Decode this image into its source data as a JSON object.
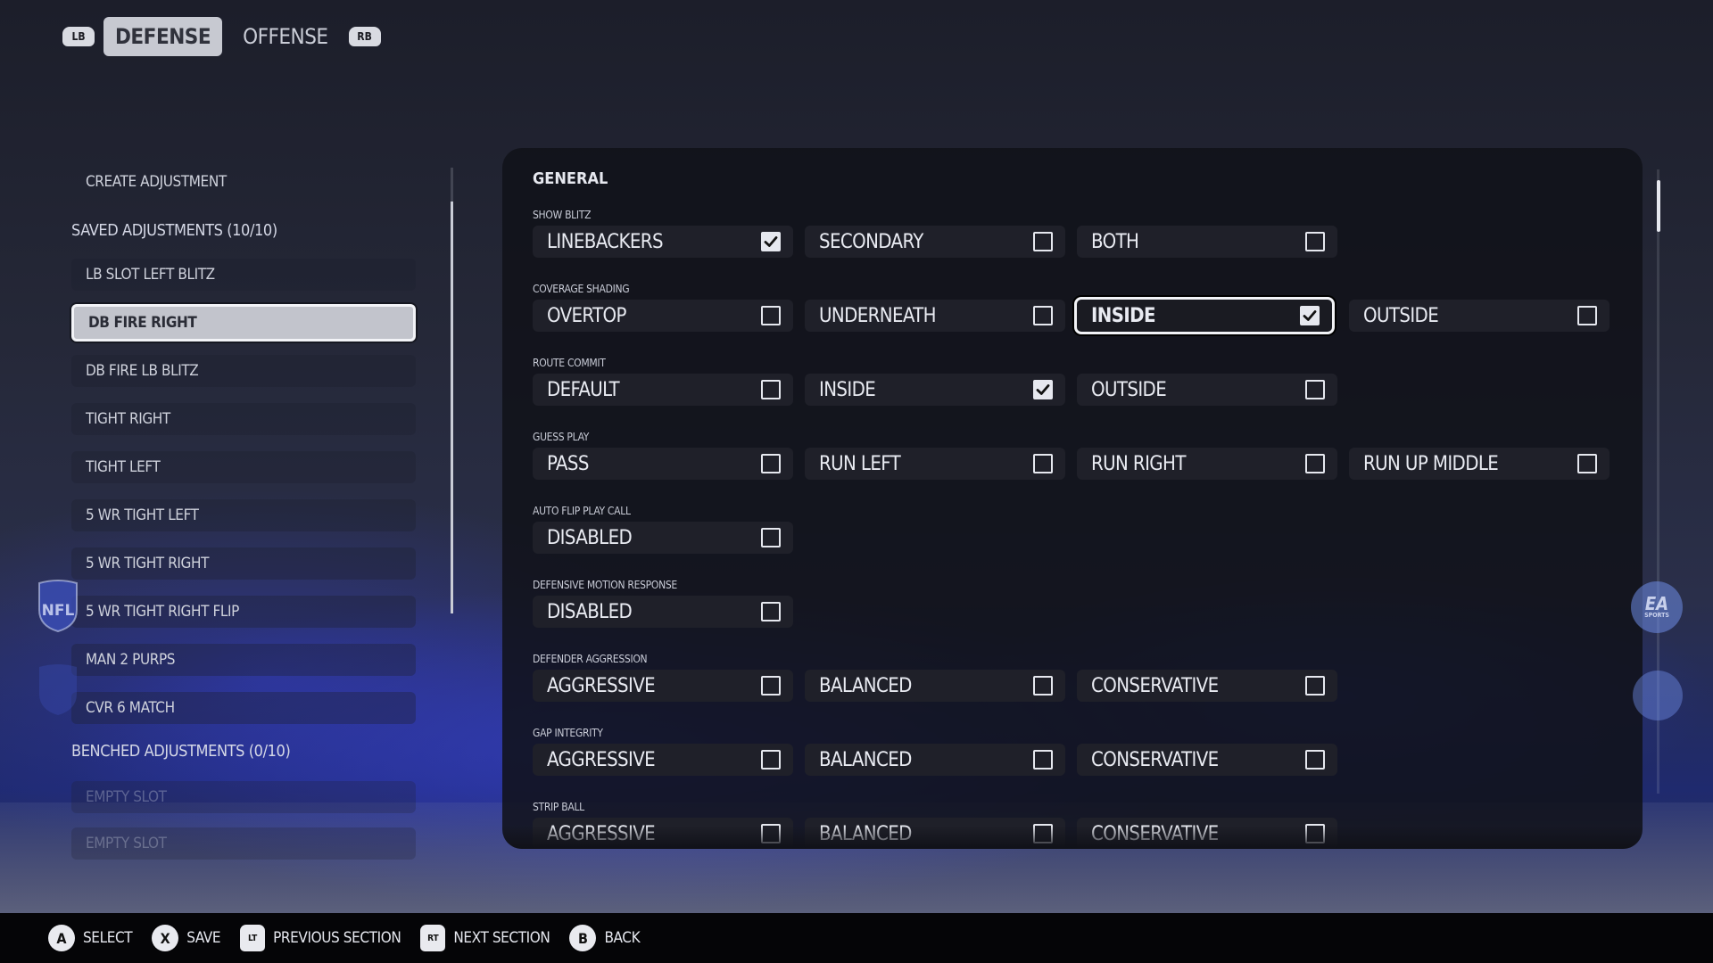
{
  "tabs": {
    "lb": "LB",
    "rb": "RB",
    "defense": "DEFENSE",
    "offense": "OFFENSE"
  },
  "left": {
    "create": "CREATE ADJUSTMENT",
    "saved_header": "SAVED ADJUSTMENTS (10/10)",
    "saved": [
      "LB SLOT LEFT BLITZ",
      "DB FIRE RIGHT",
      "DB FIRE LB BLITZ",
      "TIGHT RIGHT",
      "TIGHT LEFT",
      "5 WR TIGHT LEFT",
      "5 WR TIGHT RIGHT",
      "5 WR TIGHT RIGHT FLIP",
      "MAN 2 PURPS",
      "CVR 6 MATCH"
    ],
    "selected_index": 1,
    "benched_header": "BENCHED ADJUSTMENTS (0/10)",
    "benched": [
      "EMPTY SLOT",
      "EMPTY SLOT"
    ]
  },
  "panel": {
    "title": "GENERAL",
    "groups": [
      {
        "label": "SHOW BLITZ",
        "options": [
          {
            "label": "LINEBACKERS",
            "checked": true
          },
          {
            "label": "SECONDARY",
            "checked": false
          },
          {
            "label": "BOTH",
            "checked": false
          }
        ]
      },
      {
        "label": "COVERAGE SHADING",
        "options": [
          {
            "label": "OVERTOP",
            "checked": false
          },
          {
            "label": "UNDERNEATH",
            "checked": false
          },
          {
            "label": "INSIDE",
            "checked": true,
            "focused": true
          },
          {
            "label": "OUTSIDE",
            "checked": false
          }
        ]
      },
      {
        "label": "ROUTE COMMIT",
        "options": [
          {
            "label": "DEFAULT",
            "checked": false
          },
          {
            "label": "INSIDE",
            "checked": true
          },
          {
            "label": "OUTSIDE",
            "checked": false
          }
        ]
      },
      {
        "label": "GUESS PLAY",
        "options": [
          {
            "label": "PASS",
            "checked": false
          },
          {
            "label": "RUN LEFT",
            "checked": false
          },
          {
            "label": "RUN RIGHT",
            "checked": false
          },
          {
            "label": "RUN UP MIDDLE",
            "checked": false
          }
        ]
      },
      {
        "label": "AUTO FLIP PLAY CALL",
        "options": [
          {
            "label": "DISABLED",
            "checked": false
          }
        ]
      },
      {
        "label": "DEFENSIVE MOTION RESPONSE",
        "options": [
          {
            "label": "DISABLED",
            "checked": false
          }
        ]
      },
      {
        "label": "DEFENDER AGGRESSION",
        "options": [
          {
            "label": "AGGRESSIVE",
            "checked": false
          },
          {
            "label": "BALANCED",
            "checked": false
          },
          {
            "label": "CONSERVATIVE",
            "checked": false
          }
        ]
      },
      {
        "label": "GAP INTEGRITY",
        "options": [
          {
            "label": "AGGRESSIVE",
            "checked": false
          },
          {
            "label": "BALANCED",
            "checked": false
          },
          {
            "label": "CONSERVATIVE",
            "checked": false
          }
        ]
      },
      {
        "label": "STRIP BALL",
        "options": [
          {
            "label": "AGGRESSIVE",
            "checked": false
          },
          {
            "label": "BALANCED",
            "checked": false
          },
          {
            "label": "CONSERVATIVE",
            "checked": false
          }
        ]
      }
    ]
  },
  "hints": [
    {
      "button": "A",
      "label": "SELECT",
      "trigger": false
    },
    {
      "button": "X",
      "label": "SAVE",
      "trigger": false
    },
    {
      "button": "LT",
      "label": "PREVIOUS SECTION",
      "trigger": true
    },
    {
      "button": "RT",
      "label": "NEXT SECTION",
      "trigger": true
    },
    {
      "button": "B",
      "label": "BACK",
      "trigger": false
    }
  ],
  "icons": {
    "checkmark": "check-icon",
    "nfl": "nfl-shield-icon",
    "ea": "ea-sports-icon"
  }
}
